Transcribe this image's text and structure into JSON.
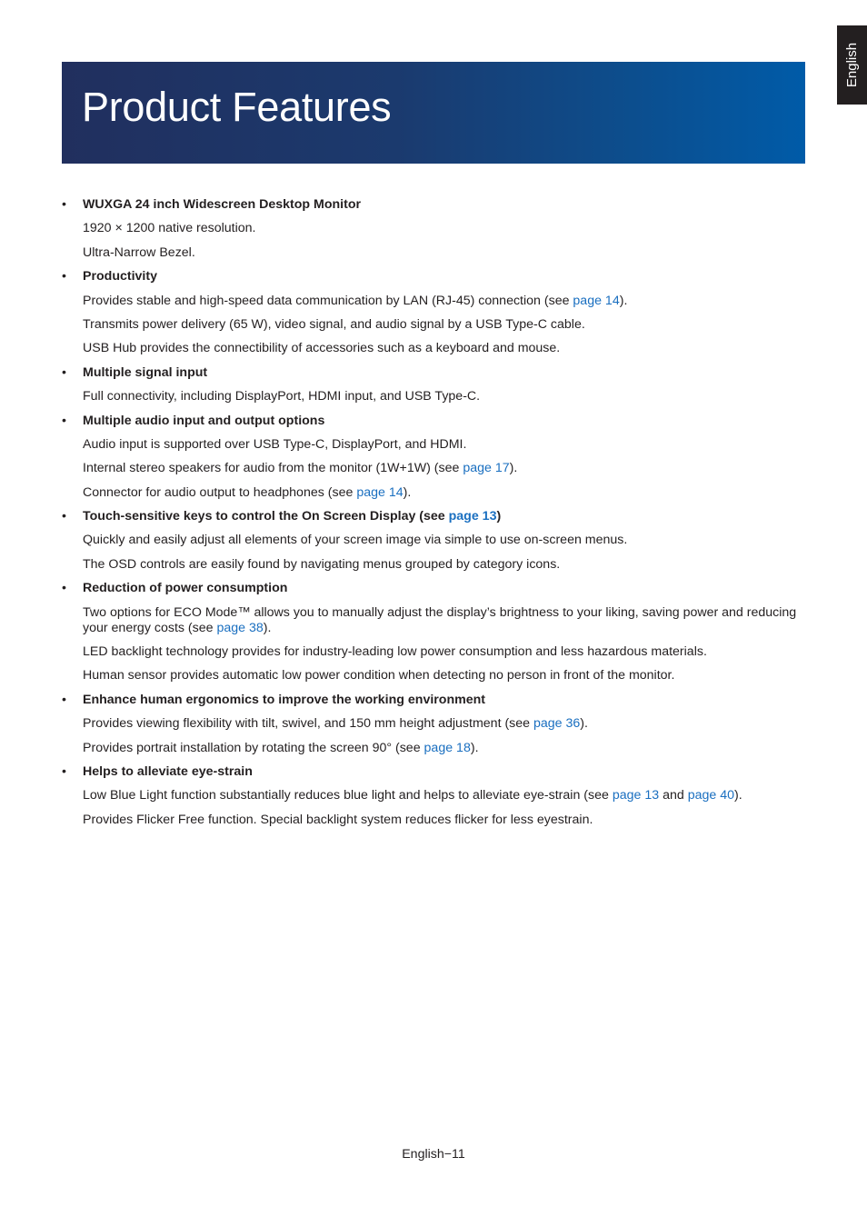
{
  "language_tab": "English",
  "page_title": "Product Features",
  "features": [
    {
      "title": "WUXGA 24 inch Widescreen Desktop Monitor",
      "lines": [
        {
          "text": "1920 × 1200 native resolution."
        },
        {
          "text": "Ultra-Narrow Bezel."
        }
      ]
    },
    {
      "title": "Productivity",
      "lines": [
        {
          "pre": "Provides stable and high-speed data communication by LAN (RJ-45) connection (see ",
          "link": "page 14",
          "post": ")."
        },
        {
          "text": "Transmits power delivery (65 W), video signal, and audio signal by a USB Type-C cable."
        },
        {
          "text": "USB Hub provides the connectibility of accessories such as a keyboard and mouse."
        }
      ]
    },
    {
      "title": "Multiple signal input",
      "lines": [
        {
          "text": "Full connectivity, including DisplayPort, HDMI input, and USB Type-C."
        }
      ]
    },
    {
      "title": "Multiple audio input and output options",
      "lines": [
        {
          "text": "Audio input is supported over USB Type-C, DisplayPort, and HDMI."
        },
        {
          "pre": "Internal stereo speakers for audio from the monitor (1W+1W) (see ",
          "link": "page 17",
          "post": ")."
        },
        {
          "pre": "Connector for audio output to headphones (see ",
          "link": "page 14",
          "post": ")."
        }
      ]
    },
    {
      "title_pre": "Touch-sensitive keys to control the On Screen Display (see ",
      "title_link": "page 13",
      "title_post": ")",
      "lines": [
        {
          "text": "Quickly and easily adjust all elements of your screen image via simple to use on-screen menus."
        },
        {
          "text": "The OSD controls are easily found by navigating menus grouped by category icons."
        }
      ]
    },
    {
      "title": "Reduction of power consumption",
      "lines": [
        {
          "pre": "Two options for ECO Mode™ allows you to manually adjust the display’s brightness to your liking, saving power and reducing your energy costs (see ",
          "link": "page 38",
          "post": ")."
        },
        {
          "text": "LED backlight technology provides for industry-leading low power consumption and less hazardous materials."
        },
        {
          "text": "Human sensor provides automatic low power condition when detecting no person in front of the monitor."
        }
      ]
    },
    {
      "title": "Enhance human ergonomics to improve the working environment",
      "lines": [
        {
          "pre": "Provides viewing flexibility with tilt, swivel, and 150 mm height adjustment (see ",
          "link": "page 36",
          "post": ")."
        },
        {
          "pre": "Provides portrait installation by rotating the screen 90° (see ",
          "link": "page 18",
          "post": ")."
        }
      ]
    },
    {
      "title": "Helps to alleviate eye-strain",
      "lines": [
        {
          "pre": "Low Blue Light function substantially reduces blue light and helps to alleviate eye-strain (see ",
          "link": "page 13",
          "mid": " and ",
          "link2": "page 40",
          "post": ")."
        },
        {
          "text": "Provides Flicker Free function. Special backlight system reduces flicker for less eyestrain."
        }
      ]
    }
  ],
  "bullet_glyph": "•",
  "footer": "English−11",
  "colors": {
    "link": "#1a6fc0",
    "banner_start": "#212f5e",
    "banner_end": "#005ba8",
    "tab_bg": "#231f20"
  }
}
